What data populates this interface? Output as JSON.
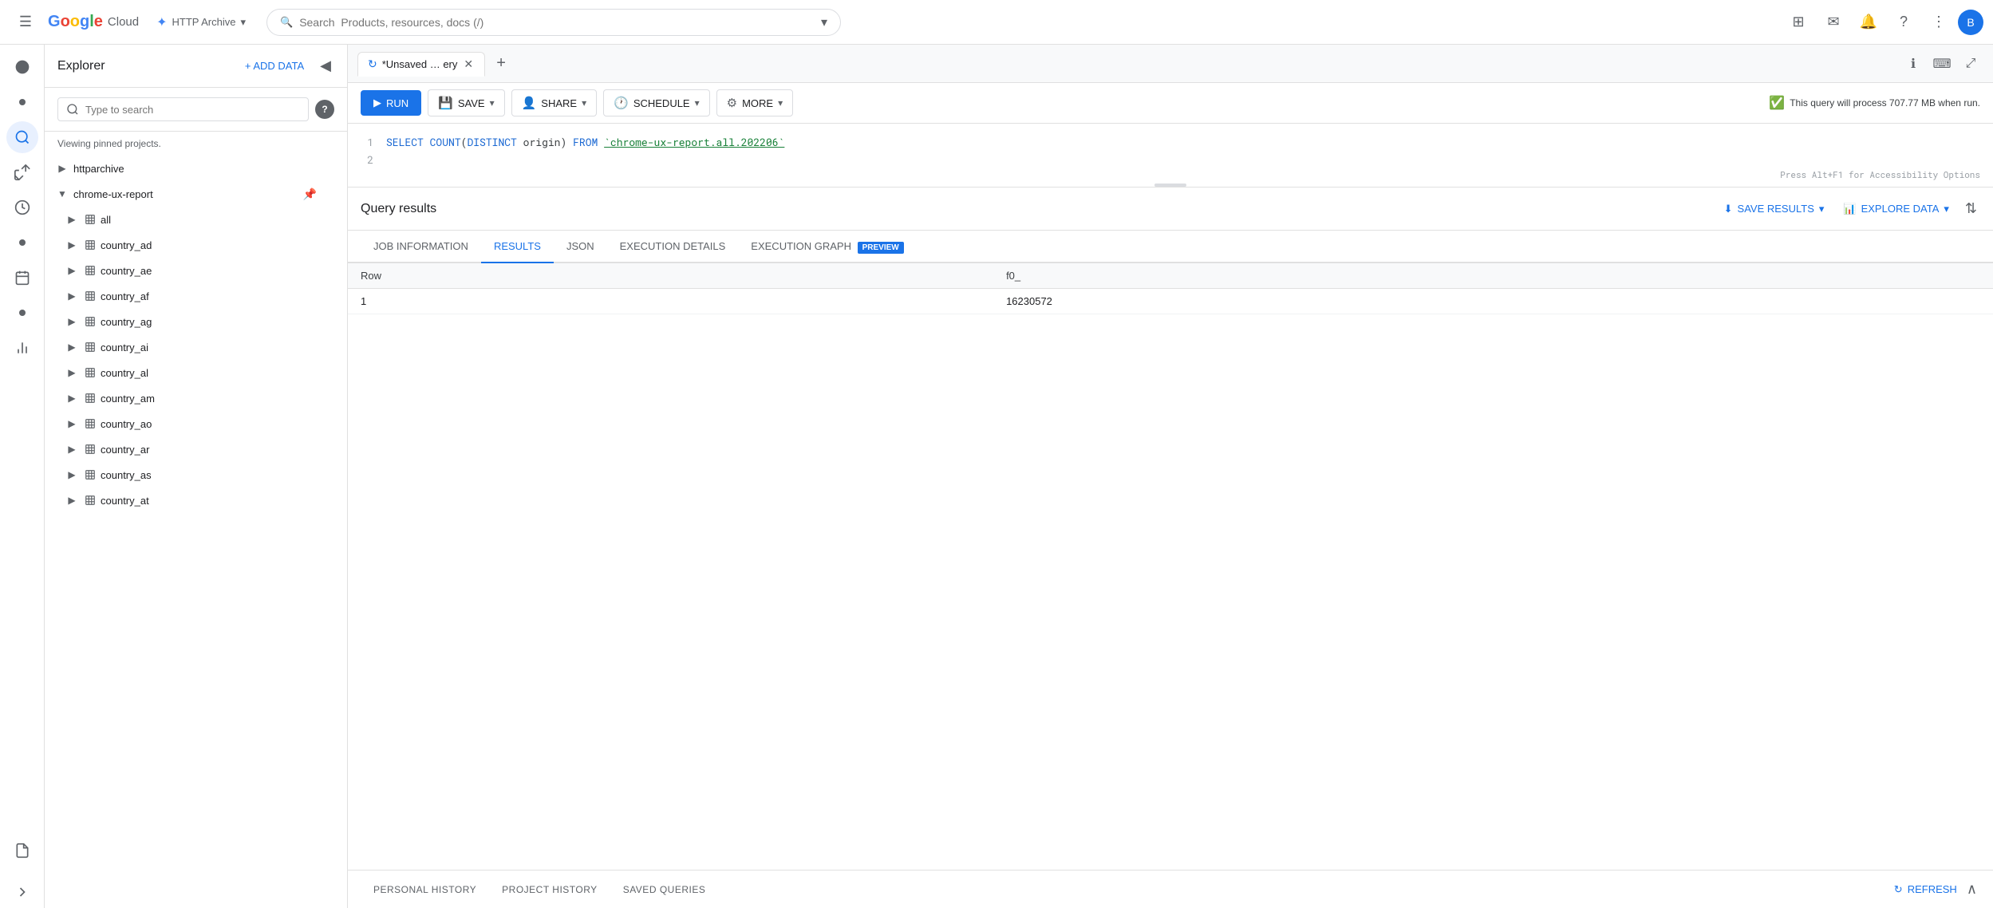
{
  "topnav": {
    "hamburger_label": "☰",
    "logo_letters": [
      "G",
      "o",
      "o",
      "g",
      "l",
      "e"
    ],
    "logo_colors": [
      "#4285f4",
      "#ea4335",
      "#fbbc05",
      "#4285f4",
      "#34a853",
      "#ea4335"
    ],
    "cloud_text": "Cloud",
    "project_name": "HTTP Archive",
    "search_placeholder": "Search  Products, resources, docs (/)",
    "icons": {
      "grid": "⊞",
      "email": "✉",
      "bell": "🔔",
      "help": "?",
      "more": "⋮",
      "avatar": "B"
    }
  },
  "sidebar": {
    "title": "Explorer",
    "add_data": "+ ADD DATA",
    "search_placeholder": "Type to search",
    "pinned_note": "Viewing pinned projects.",
    "tree": [
      {
        "id": "httparchive",
        "label": "httparchive",
        "level": 0,
        "expanded": false,
        "type": "project"
      },
      {
        "id": "chrome-ux-report",
        "label": "chrome-ux-report",
        "level": 0,
        "expanded": true,
        "type": "project",
        "pinned": true
      },
      {
        "id": "all",
        "label": "all",
        "level": 1,
        "type": "table"
      },
      {
        "id": "country_ad",
        "label": "country_ad",
        "level": 1,
        "type": "table"
      },
      {
        "id": "country_ae",
        "label": "country_ae",
        "level": 1,
        "type": "table"
      },
      {
        "id": "country_af",
        "label": "country_af",
        "level": 1,
        "type": "table"
      },
      {
        "id": "country_ag",
        "label": "country_ag",
        "level": 1,
        "type": "table"
      },
      {
        "id": "country_ai",
        "label": "country_ai",
        "level": 1,
        "type": "table"
      },
      {
        "id": "country_al",
        "label": "country_al",
        "level": 1,
        "type": "table"
      },
      {
        "id": "country_am",
        "label": "country_am",
        "level": 1,
        "type": "table"
      },
      {
        "id": "country_ao",
        "label": "country_ao",
        "level": 1,
        "type": "table"
      },
      {
        "id": "country_ar",
        "label": "country_ar",
        "level": 1,
        "type": "table"
      },
      {
        "id": "country_as",
        "label": "country_as",
        "level": 1,
        "type": "table"
      },
      {
        "id": "country_at",
        "label": "country_at",
        "level": 1,
        "type": "table"
      }
    ]
  },
  "query_editor": {
    "tab_name": "*Unsaved … ery",
    "query_line1": "SELECT COUNT(DISTINCT origin) FROM `chrome-ux-report.all.202206`",
    "query_line2": "",
    "query_info": "This query will process 707.77 MB when run.",
    "toolbar": {
      "run": "RUN",
      "save": "SAVE",
      "share": "SHARE",
      "schedule": "SCHEDULE",
      "more": "MORE"
    }
  },
  "results": {
    "title": "Query results",
    "save_results": "SAVE RESULTS",
    "explore_data": "EXPLORE DATA",
    "tabs": [
      {
        "id": "job_info",
        "label": "JOB INFORMATION",
        "active": false
      },
      {
        "id": "results",
        "label": "RESULTS",
        "active": true
      },
      {
        "id": "json",
        "label": "JSON",
        "active": false
      },
      {
        "id": "execution_details",
        "label": "EXECUTION DETAILS",
        "active": false
      },
      {
        "id": "execution_graph",
        "label": "EXECUTION GRAPH",
        "active": false,
        "badge": "PREVIEW"
      }
    ],
    "table": {
      "columns": [
        "Row",
        "f0_"
      ],
      "rows": [
        {
          "row": "1",
          "f0_": "16230572"
        }
      ]
    }
  },
  "history": {
    "tabs": [
      {
        "id": "personal_history",
        "label": "PERSONAL HISTORY"
      },
      {
        "id": "project_history",
        "label": "PROJECT HISTORY"
      },
      {
        "id": "saved_queries",
        "label": "SAVED QUERIES"
      }
    ],
    "refresh": "REFRESH"
  }
}
